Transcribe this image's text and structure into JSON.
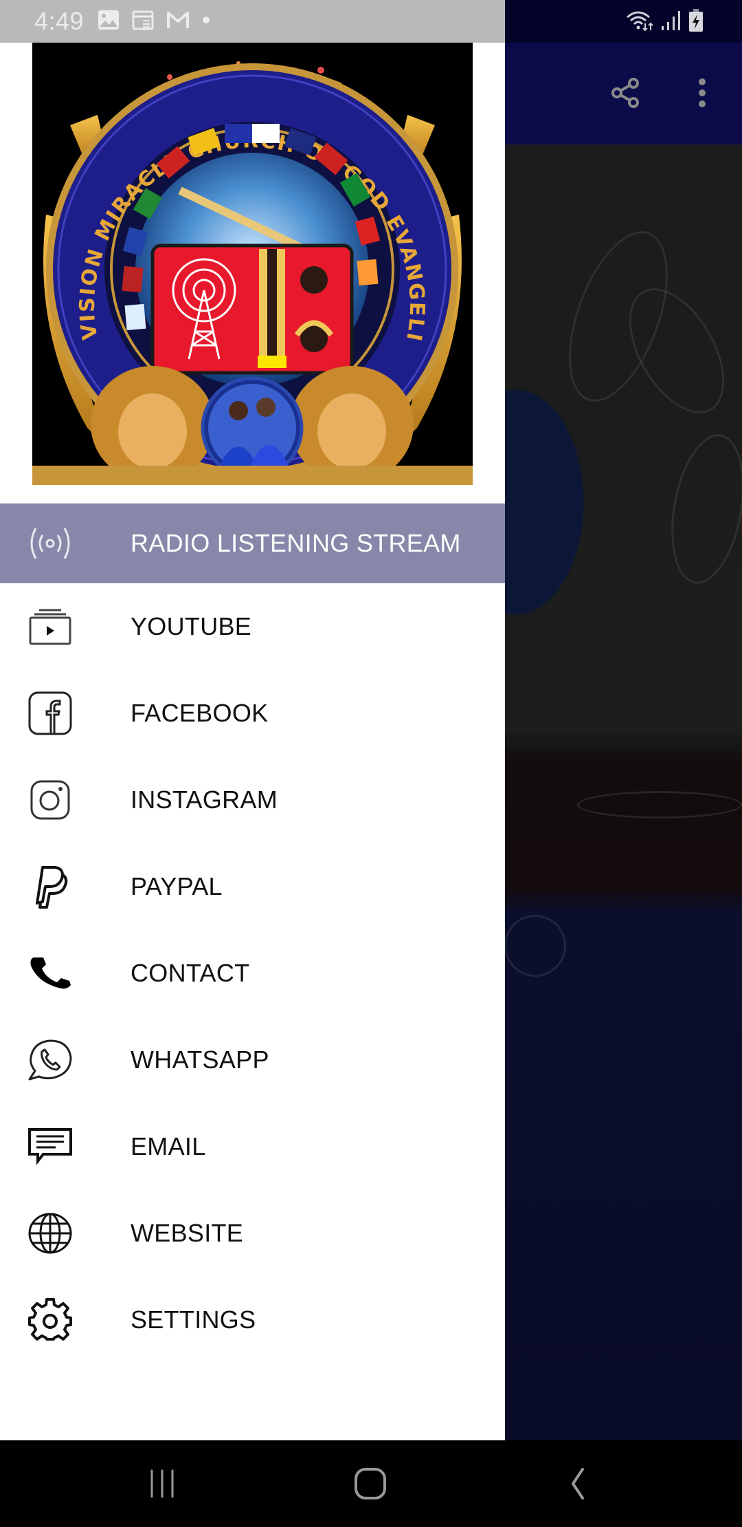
{
  "status_bar": {
    "time": "4:49",
    "left_icons": [
      "image-icon",
      "calendar-news-icon",
      "gmail-icon",
      "dot-icon"
    ],
    "right_icons": [
      "wifi-icon",
      "signal-icon",
      "battery-charging-icon"
    ]
  },
  "toolbar": {
    "share_icon": "share-icon",
    "more_icon": "more-vert-icon"
  },
  "drawer": {
    "logo": {
      "alt": "Vision Miracle Church of God Evangelistic Association logo",
      "ring_text": "VISION MIRACLE CHURCH OF GOD EVANGELISTIC ASSOCIATION"
    },
    "menu": [
      {
        "label": "RADIO LISTENING STREAM",
        "icon": "radio-broadcast-icon",
        "active": true
      },
      {
        "label": "YOUTUBE",
        "icon": "video-library-icon",
        "active": false
      },
      {
        "label": "FACEBOOK",
        "icon": "facebook-icon",
        "active": false
      },
      {
        "label": "INSTAGRAM",
        "icon": "instagram-icon",
        "active": false
      },
      {
        "label": "PAYPAL",
        "icon": "paypal-icon",
        "active": false
      },
      {
        "label": "CONTACT",
        "icon": "phone-icon",
        "active": false
      },
      {
        "label": "WHATSAPP",
        "icon": "whatsapp-icon",
        "active": false
      },
      {
        "label": "EMAIL",
        "icon": "message-icon",
        "active": false
      },
      {
        "label": "WEBSITE",
        "icon": "globe-icon",
        "active": false
      },
      {
        "label": "SETTINGS",
        "icon": "gear-icon",
        "active": false
      }
    ]
  },
  "nav_bar": {
    "recents": "recents-icon",
    "home": "home-icon",
    "back": "back-icon"
  },
  "colors": {
    "active_item_bg": "#8787a9",
    "toolbar_bg": "#0b0b4a",
    "drawer_status_bg": "#b9b9b9",
    "nav_bar_bg": "#000000"
  }
}
